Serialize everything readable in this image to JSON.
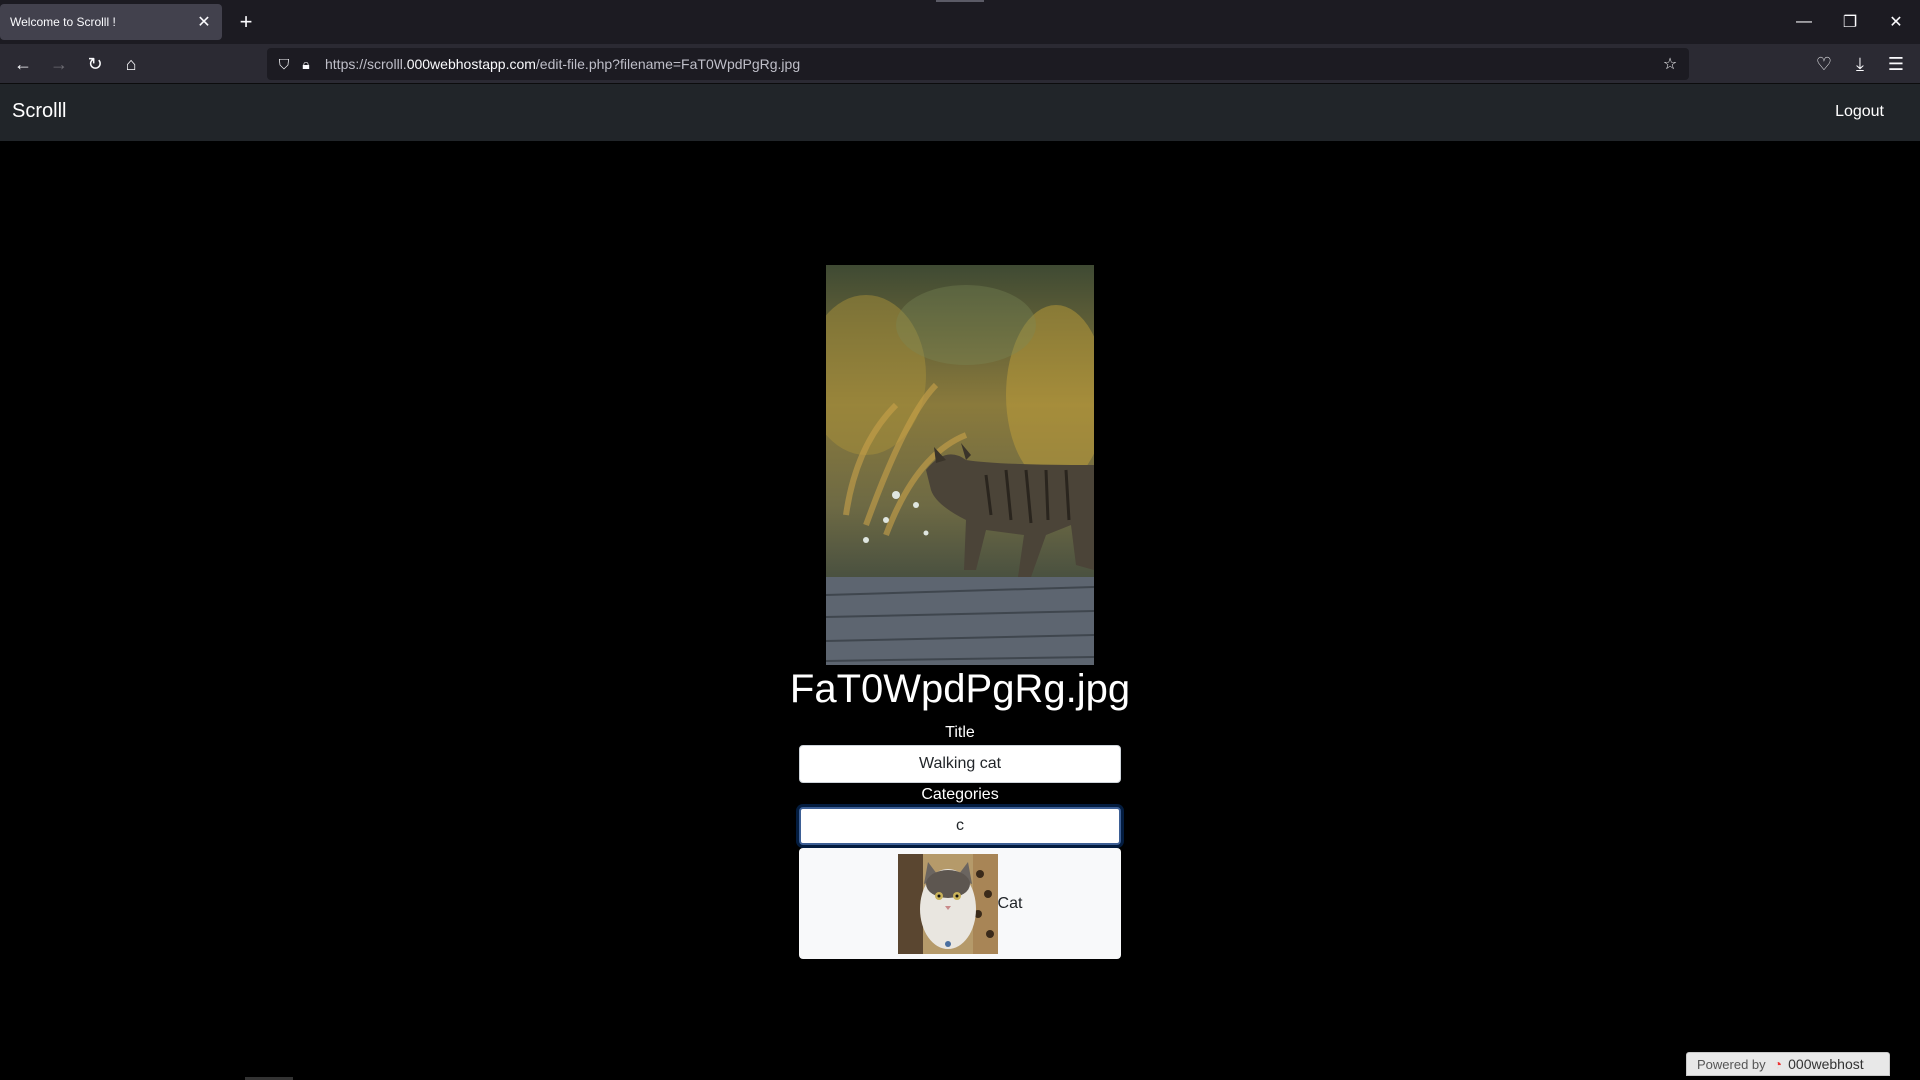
{
  "browser": {
    "tab_title": "Welcome to Scrolll !",
    "url_prefix": "https://scrolll.",
    "url_domain": "000webhostapp.com",
    "url_path": "/edit-file.php?filename=FaT0WpdPgRg.jpg"
  },
  "site": {
    "brand": "Scrolll",
    "logout_label": "Logout"
  },
  "form": {
    "filename": "FaT0WpdPgRg.jpg",
    "title_label": "Title",
    "title_value": "Walking cat",
    "categories_label": "Categories",
    "categories_value": "c",
    "suggestion": {
      "name": "Cat"
    }
  },
  "footer": {
    "powered_by": "Powered by",
    "host": "000webhost"
  }
}
